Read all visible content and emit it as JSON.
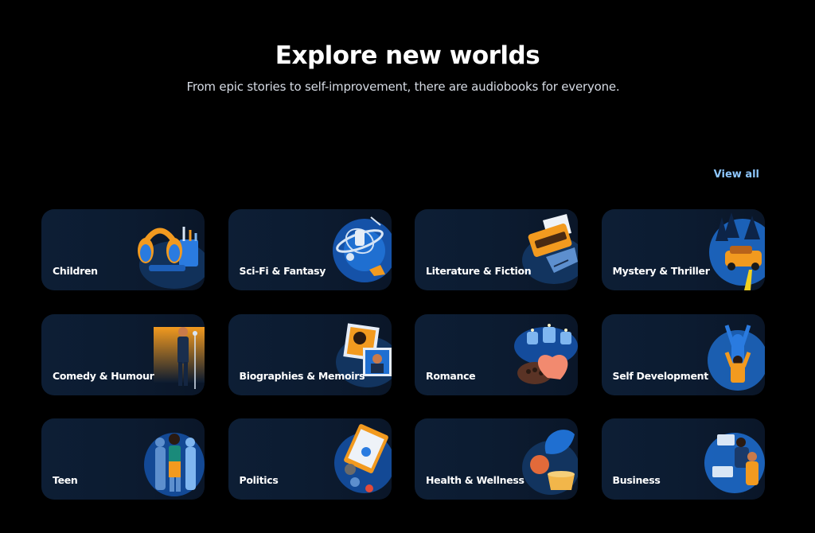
{
  "header": {
    "title": "Explore new worlds",
    "subtitle": "From epic stories to self-improvement, there are audiobooks for everyone."
  },
  "view_all_label": "View all",
  "categories": [
    {
      "label": "Children",
      "icon": "headphones-icon"
    },
    {
      "label": "Sci-Fi & Fantasy",
      "icon": "spaceship-icon"
    },
    {
      "label": "Literature & Fiction",
      "icon": "typewriter-icon"
    },
    {
      "label": "Mystery & Thriller",
      "icon": "car-in-forest-icon"
    },
    {
      "label": "Comedy & Humour",
      "icon": "comedian-microphone-icon"
    },
    {
      "label": "Biographies & Memoirs",
      "icon": "portrait-photos-icon"
    },
    {
      "label": "Romance",
      "icon": "heart-chocolates-candles-icon"
    },
    {
      "label": "Self Development",
      "icon": "raised-arms-figures-icon"
    },
    {
      "label": "Teen",
      "icon": "teen-group-icon"
    },
    {
      "label": "Politics",
      "icon": "clipboard-badges-icon"
    },
    {
      "label": "Health & Wellness",
      "icon": "plant-fruit-tea-icon"
    },
    {
      "label": "Business",
      "icon": "business-meeting-icon"
    }
  ],
  "colors": {
    "background": "#000000",
    "card": "#0d1e35",
    "accent_link": "#8ec7ff",
    "illustration_blue": "#1f6fd1",
    "illustration_orange": "#f29a1f"
  }
}
